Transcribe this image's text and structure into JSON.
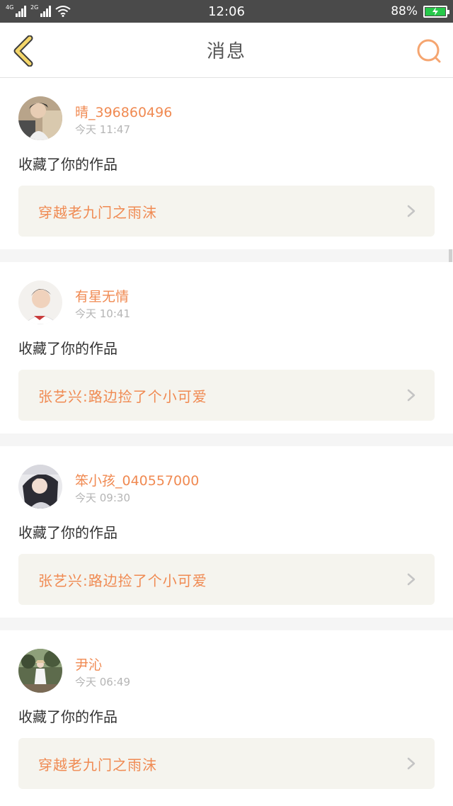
{
  "status_bar": {
    "net1": "4G",
    "net2": "2G",
    "time": "12:06",
    "battery": "88%"
  },
  "header": {
    "title": "消息",
    "back_icon": "chevron-left-icon",
    "search_icon": "search-icon"
  },
  "colors": {
    "accent": "#f08a52",
    "back_icon_fill": "#f4d66a",
    "card_box": "#f5f4ee"
  },
  "messages": [
    {
      "user": "晴_396860496",
      "time": "今天 11:47",
      "action": "收藏了你的作品",
      "work": "穿越老九门之雨沫"
    },
    {
      "user": "有星无情",
      "time": "今天 10:41",
      "action": "收藏了你的作品",
      "work": "张艺兴:路边捡了个小可爱"
    },
    {
      "user": "笨小孩_040557000",
      "time": "今天 09:30",
      "action": "收藏了你的作品",
      "work": "张艺兴:路边捡了个小可爱"
    },
    {
      "user": "尹沁",
      "time": "今天 06:49",
      "action": "收藏了你的作品",
      "work": "穿越老九门之雨沫"
    }
  ]
}
